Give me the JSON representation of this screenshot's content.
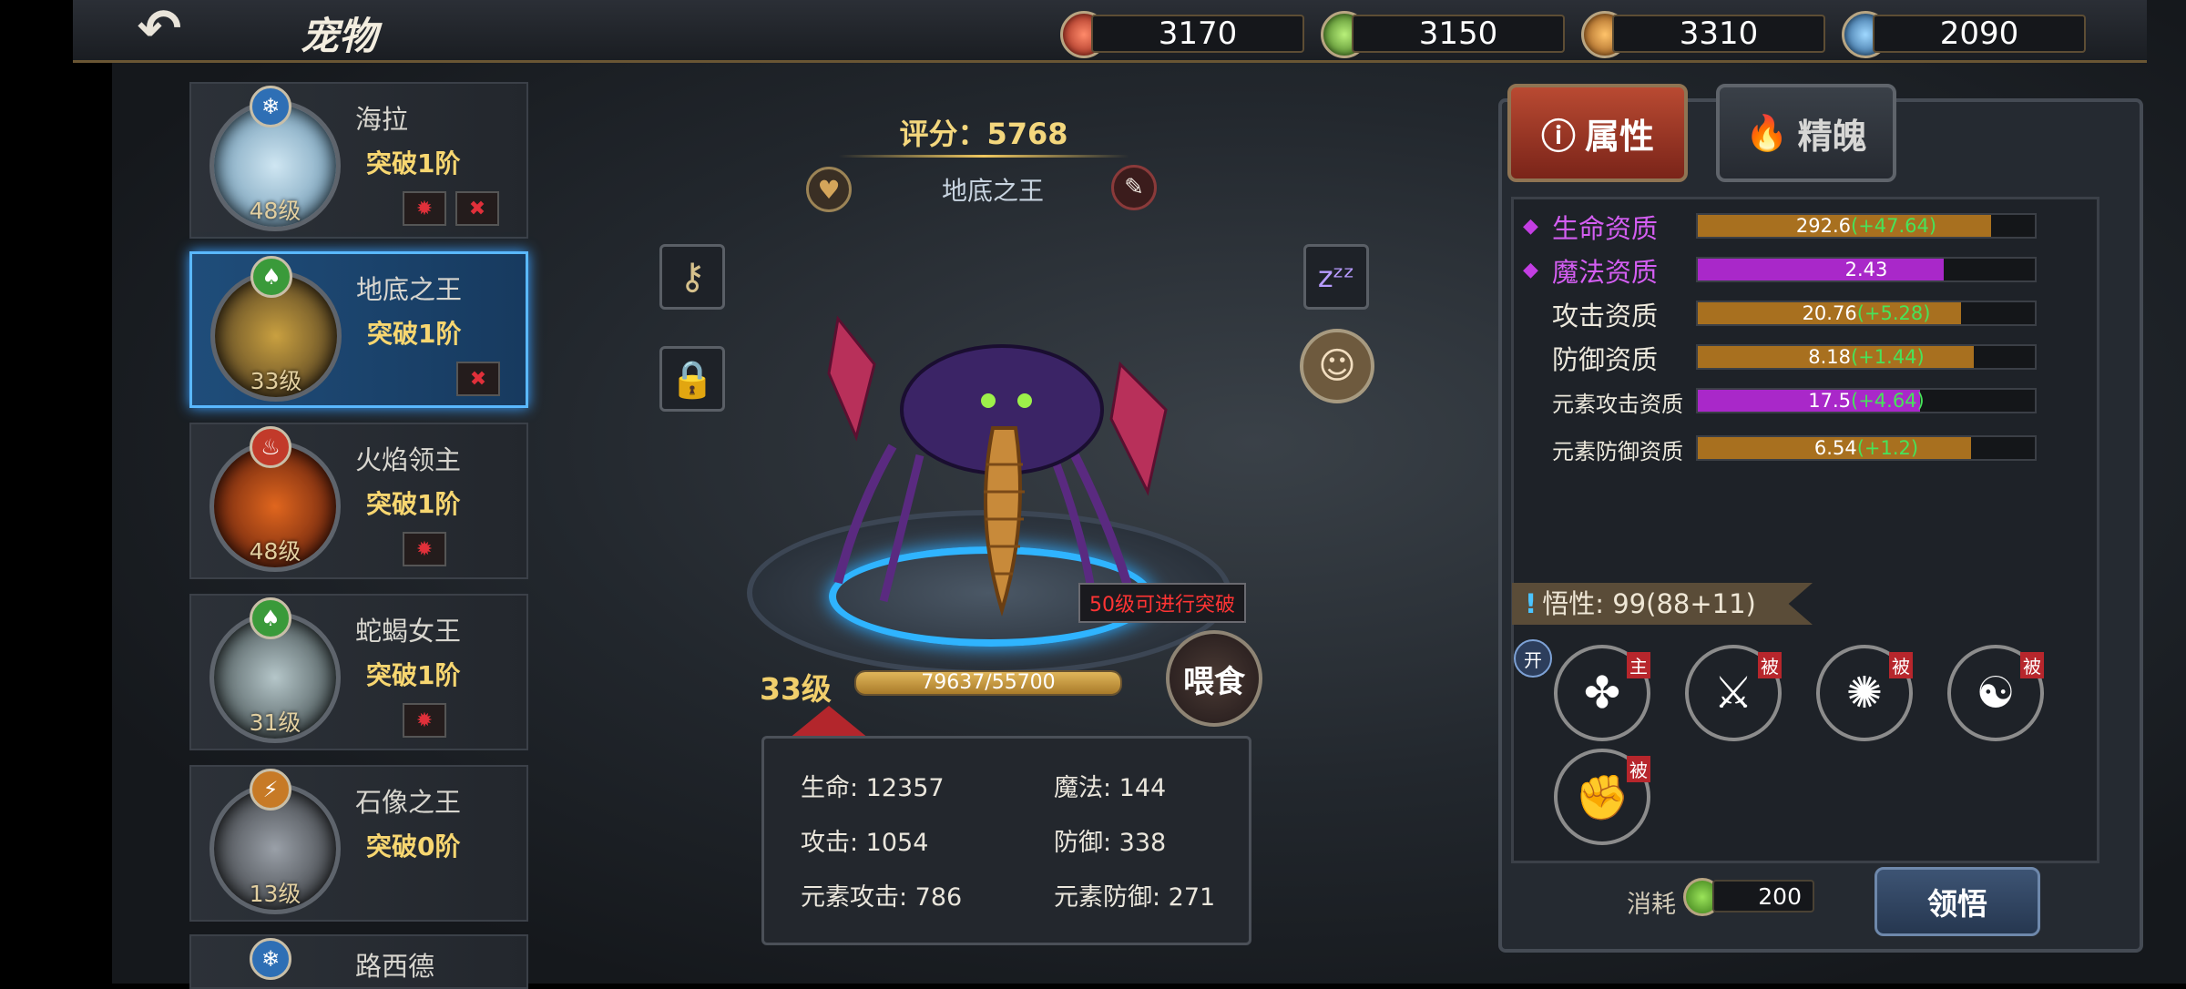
{
  "header": {
    "title": "宠物",
    "resources": [
      {
        "icon": "red-gem-icon",
        "color": "#d43a2c",
        "value": "3170"
      },
      {
        "icon": "green-gem-icon",
        "color": "#5fb83a",
        "value": "3150"
      },
      {
        "icon": "orange-lightning-gem-icon",
        "color": "#e08a2a",
        "value": "3310"
      },
      {
        "icon": "blue-snowflake-gem-icon",
        "color": "#3a9ad9",
        "value": "2090"
      }
    ]
  },
  "pets": [
    {
      "name": "海拉",
      "stage": "突破1阶",
      "level": "48级",
      "element_icon": "snowflake-icon",
      "element_glyph": "❄",
      "element_color": "#2e6fb5",
      "portrait_color": "#8ab8d6",
      "badge1": "✹",
      "badge2": "✖"
    },
    {
      "name": "地底之王",
      "stage": "突破1阶",
      "level": "33级",
      "element_icon": "leaf-icon",
      "element_glyph": "♠",
      "element_color": "#3a9a3a",
      "portrait_color": "#6a5a3c",
      "badge1": "✖"
    },
    {
      "name": "火焰领主",
      "stage": "突破1阶",
      "level": "48级",
      "element_icon": "flame-icon",
      "element_glyph": "♨",
      "element_color": "#c23a2a",
      "portrait_color": "#a63a1c",
      "badge1": "✹"
    },
    {
      "name": "蛇蝎女王",
      "stage": "突破1阶",
      "level": "31级",
      "element_icon": "leaf-icon",
      "element_glyph": "♠",
      "element_color": "#3a9a3a",
      "portrait_color": "#5e6e72",
      "badge1": "✹"
    },
    {
      "name": "石像之王",
      "stage": "突破0阶",
      "level": "13级",
      "element_icon": "lightning-icon",
      "element_glyph": "⚡",
      "element_color": "#c77a26",
      "portrait_color": "#6b6f75"
    },
    {
      "name": "路西德",
      "element_icon": "snowflake-icon",
      "element_glyph": "❄",
      "element_color": "#2e6fb5"
    }
  ],
  "center": {
    "score_label": "评分：5768",
    "pet_name": "地底之王",
    "breakthrough_tip": "50级可进行突破",
    "feed_label": "喂食",
    "level": "33级",
    "exp_text": "79637/55700",
    "exp_fill": 1.0,
    "stats": {
      "hp": "生命: 12357",
      "mp": "魔法: 144",
      "atk": "攻击: 1054",
      "def": "防御: 338",
      "eatk": "元素攻击: 786",
      "edef": "元素防御: 271"
    }
  },
  "right": {
    "tab_attr": "属性",
    "tab_soul": "精魄",
    "attributes": [
      {
        "label": "生命资质",
        "value": "292.6",
        "bonus": "(+47.64)",
        "fill": 0.87,
        "color": "#a8701f",
        "highlight": true
      },
      {
        "label": "魔法资质",
        "value": "2.43",
        "bonus": "",
        "fill": 0.73,
        "color": "#a928c9",
        "highlight": true
      },
      {
        "label": "攻击资质",
        "value": "20.76",
        "bonus": "(+5.28)",
        "fill": 0.78,
        "color": "#a8701f",
        "highlight": false
      },
      {
        "label": "防御资质",
        "value": "8.18",
        "bonus": "(+1.44)",
        "fill": 0.82,
        "color": "#a8701f",
        "highlight": false
      },
      {
        "label": "元素攻击资质",
        "value": "17.5",
        "bonus": "(+4.64)",
        "fill": 0.66,
        "color": "#a928c9",
        "highlight": false,
        "small": true
      },
      {
        "label": "元素防御资质",
        "value": "6.54",
        "bonus": "(+1.2)",
        "fill": 0.81,
        "color": "#a8701f",
        "highlight": false,
        "small": true
      }
    ],
    "insight_text": "悟性: 99(88+11)",
    "open_tag": "开",
    "skills": [
      {
        "icon": "green-claw-skill-icon",
        "tag": "主",
        "color": "#5a8a1e"
      },
      {
        "icon": "orange-slash-skill-icon",
        "tag": "被",
        "color": "#a2561c"
      },
      {
        "icon": "green-swirl-skill-icon",
        "tag": "被",
        "color": "#4b8a1a"
      },
      {
        "icon": "blue-meditation-skill-icon",
        "tag": "被",
        "color": "#1e56b0"
      },
      {
        "icon": "red-fist-skill-icon",
        "tag": "被",
        "color": "#9e2020"
      }
    ],
    "cost_label": "消耗",
    "cost_value": "200",
    "comprehend_label": "领悟"
  }
}
